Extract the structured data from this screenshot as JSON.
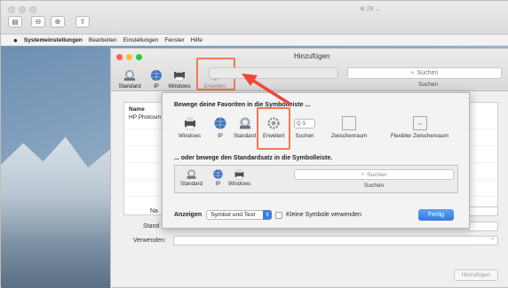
{
  "outer": {
    "zoom_indicator": "⊕ 28 ⌄"
  },
  "menubar": {
    "apple": "",
    "items": [
      "Systemeinstellungen",
      "Bearbeiten",
      "Einstellungen",
      "Fenster",
      "Hilfe"
    ]
  },
  "prefs_window": {
    "title": "Hinzufügen",
    "toolbar": [
      {
        "label": "Standard",
        "icon": "printer-icon"
      },
      {
        "label": "IP",
        "icon": "globe-icon"
      },
      {
        "label": "Windows",
        "icon": "windows-printer-icon"
      },
      {
        "label": "Erweitert",
        "icon": "gear-icon"
      }
    ],
    "search_placeholder": "Suchen",
    "search_label": "Suchen",
    "table_header": "Name",
    "table_rows": [
      "HP Photosm"
    ],
    "form": {
      "name_label": "Na",
      "location_label": "Stand",
      "use_label": "Verwenden:"
    },
    "add_button": "Hinzufügen"
  },
  "sheet": {
    "heading_favorites": "Bewege deine Favoriten in die Symbolleiste ...",
    "favorites": [
      {
        "label": "Windows",
        "icon": "windows-printer-icon"
      },
      {
        "label": "IP",
        "icon": "globe-icon"
      },
      {
        "label": "Standard",
        "icon": "printer-icon"
      },
      {
        "label": "Erweitert",
        "icon": "gear-icon"
      },
      {
        "label": "Suchen",
        "icon": "search-field-icon"
      },
      {
        "label": "Zwischenraum",
        "icon": "space-icon"
      },
      {
        "label": "Flexibler Zwischenraum",
        "icon": "flexible-space-icon"
      }
    ],
    "heading_default": "... oder bewege den Standardsatz in die Symbolleiste.",
    "default_set": [
      {
        "label": "Standard",
        "icon": "printer-icon"
      },
      {
        "label": "IP",
        "icon": "globe-icon"
      },
      {
        "label": "Windows",
        "icon": "windows-printer-icon"
      }
    ],
    "default_search_placeholder": "Suchen",
    "default_search_label": "Suchen",
    "show_label": "Anzeigen",
    "show_value": "Symbol und Text",
    "small_icons_label": "Kleine Symbole verwenden",
    "done_button": "Fertig",
    "search_mini": "Q S"
  },
  "colors": {
    "highlight": "#f07a52",
    "accent": "#3678e0"
  }
}
